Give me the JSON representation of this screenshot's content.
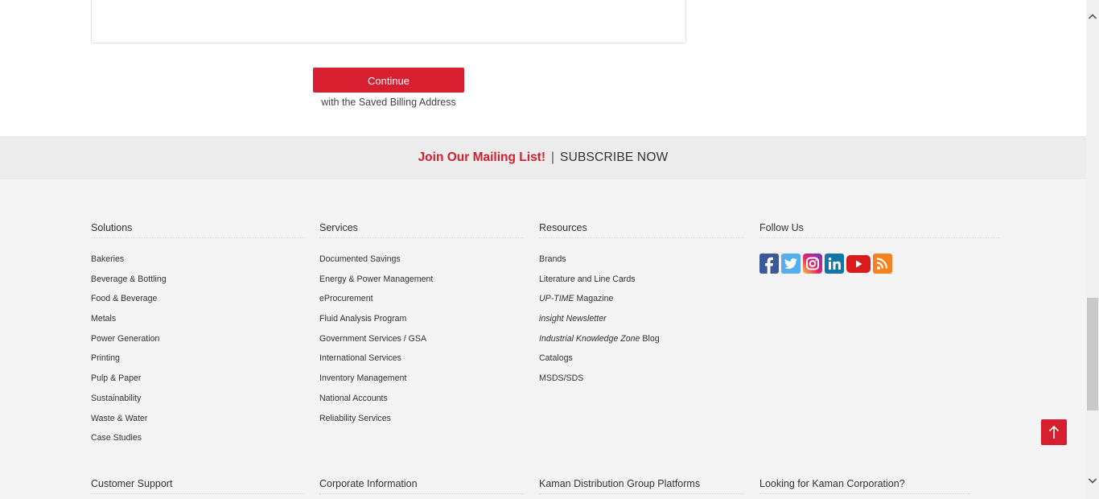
{
  "billing": {
    "continue_label": "Continue",
    "continue_note": "with the Saved Billing Address"
  },
  "mailing": {
    "join_label": "Join Our Mailing List!",
    "separator": "|",
    "subscribe_label": "SUBSCRIBE NOW"
  },
  "footer": {
    "solutions": {
      "title": "Solutions",
      "items": [
        "Bakeries",
        "Beverage & Bottling",
        "Food & Beverage",
        "Metals",
        "Power Generation",
        "Printing",
        "Pulp & Paper",
        "Sustainability",
        "Waste & Water",
        "Case Studies"
      ]
    },
    "services": {
      "title": "Services",
      "items": [
        "Documented Savings",
        "Energy & Power Management",
        "eProcurement",
        "Fluid Analysis Program",
        "Government Services / GSA",
        "International Services",
        "Inventory Management",
        "National Accounts",
        "Reliability Services"
      ]
    },
    "resources": {
      "title": "Resources",
      "brands": "Brands",
      "literature": "Literature and Line Cards",
      "uptime_italic": "UP-TIME",
      "uptime_rest": " Magazine",
      "insight_italic": "insight",
      "insight_rest": " Newsletter",
      "ikz_italic": "Industrial Knowledge Zone",
      "ikz_rest": " Blog",
      "catalogs": "Catalogs",
      "msds": "MSDS/SDS"
    },
    "follow": {
      "title": "Follow Us",
      "icons": [
        "facebook-icon",
        "twitter-icon",
        "instagram-icon",
        "linkedin-icon",
        "youtube-icon",
        "rss-icon"
      ]
    },
    "bottom": {
      "customer_support": "Customer Support",
      "corporate_information": "Corporate Information",
      "platforms": "Kaman Distribution Group Platforms",
      "kaman_corp": "Looking for Kaman Corporation?"
    }
  },
  "colors": {
    "brand_red": "#d71f2f",
    "footer_bg": "#f4f4f4",
    "mailing_bg": "#ececec"
  }
}
